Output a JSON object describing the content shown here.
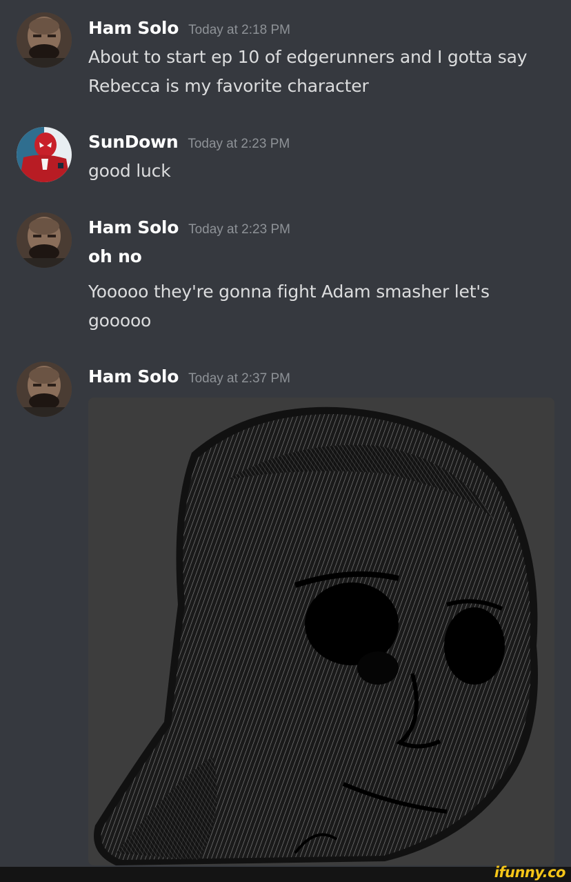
{
  "messages": [
    {
      "username": "Ham Solo",
      "timestamp": "Today at 2:18 PM",
      "lines": [
        "About to start ep 10 of edgerunners and I gotta say",
        "Rebecca is my favorite character"
      ]
    },
    {
      "username": "SunDown",
      "timestamp": "Today at 2:23 PM",
      "lines": [
        "good luck"
      ]
    },
    {
      "username": "Ham Solo",
      "timestamp": "Today at 2:23 PM",
      "bold_line": "oh no",
      "lines": [
        "Yooooo they're gonna fight Adam smasher let's",
        "gooooo"
      ]
    },
    {
      "username": "Ham Solo",
      "timestamp": "Today at 2:37 PM",
      "image": "sad-wojak-face-meme"
    }
  ],
  "watermark": "ifunny.co",
  "colors": {
    "background": "#36393f",
    "username": "#ffffff",
    "timestamp": "#8e9297",
    "message_text": "#dcddde",
    "watermark": "#f5c518"
  }
}
